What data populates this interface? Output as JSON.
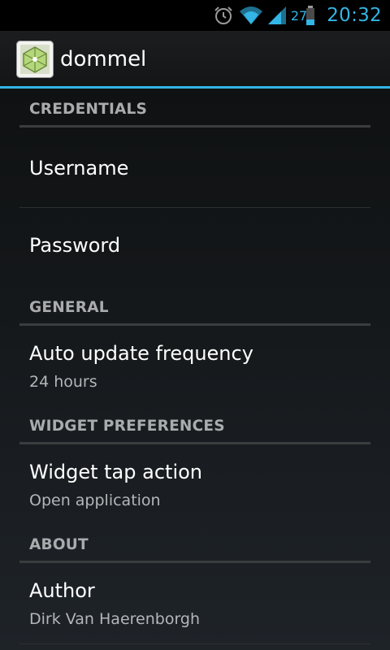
{
  "status_bar": {
    "battery_level": "27",
    "time": "20:32",
    "icons": [
      "alarm-icon",
      "wifi-icon",
      "signal-icon",
      "battery-icon"
    ],
    "accent_color": "#33b5e5"
  },
  "action_bar": {
    "title": "dommel",
    "icon": "app-icon"
  },
  "sections": {
    "credentials": {
      "header": "CREDENTIALS",
      "username": {
        "title": "Username"
      },
      "password": {
        "title": "Password"
      }
    },
    "general": {
      "header": "GENERAL",
      "auto_update": {
        "title": "Auto update frequency",
        "summary": "24 hours"
      }
    },
    "widget": {
      "header": "WIDGET PREFERENCES",
      "tap_action": {
        "title": "Widget tap action",
        "summary": "Open application"
      }
    },
    "about": {
      "header": "ABOUT",
      "author": {
        "title": "Author",
        "summary": "Dirk Van Haerenborgh"
      }
    }
  }
}
